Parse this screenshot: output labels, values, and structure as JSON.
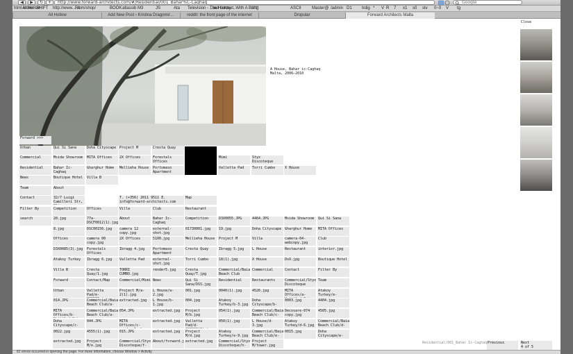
{
  "browser": {
    "url": "http://www.forward-architects.com/#/Residential/001_Bahar%C-Caghaq",
    "search_placeholder": "Google",
    "nav_back": "◀",
    "nav_forward": "▶",
    "nav_reload": "↻",
    "nav_add": "+",
    "bookmarks": [
      "html video",
      "All Hollow",
      "SHIFT",
      "http://www....com/shop/",
      "FA",
      "BOOK",
      "atlassib",
      "M3",
      "JS",
      "Ata",
      "Television - ...out context",
      "The History ...With A Bang",
      "!!!!!!",
      "ASCII",
      "Master@",
      "/admin",
      "D1",
      "trdig",
      "*",
      "V",
      "R",
      "7",
      "x1",
      "s0",
      "stv",
      "0~0",
      "V",
      "tg"
    ],
    "tabs": [
      {
        "label": "All Hollow",
        "active": false
      },
      {
        "label": "Add New Post ‹ Kristina Dragomir…",
        "active": false
      },
      {
        "label": "reddit: the front page of the internet",
        "active": false
      },
      {
        "label": "Dropular",
        "active": false
      },
      {
        "label": "Forward Architects Malta",
        "active": true
      }
    ],
    "status_text": "82 errors occurred in opening the page. For more information, choose Window > Activity."
  },
  "project": {
    "caption_title": "A House, Bahar ic-Caghaq",
    "caption_sub": "Malta, 2006–2010"
  },
  "thumbs": {
    "close_label": "Close"
  },
  "footer": {
    "path": "Residential/001_Bahar Ic-Caghaq",
    "previous": "Previous",
    "next": "Next",
    "count": "4 of 5"
  },
  "menu": {
    "forward": "Forward >>>"
  },
  "grid": [
    [
      "Urban",
      "Qui Si Sana",
      "Doha Cityscape",
      "Project M",
      "Cresta Quay"
    ],
    [
      "Commercial",
      "Msida Showroom",
      "MITA Offices",
      "2X Offices",
      "Forestals Offices",
      "",
      "Mimi",
      "Styx Discoteque"
    ],
    [
      "Residential",
      "Bahar Ic-Caghaq",
      "Gharghur Home",
      "Mellieha House",
      "Portomaso Apartment",
      "",
      "Valletta Pad",
      "Torri Cumbo",
      "X House"
    ],
    [
      "News",
      "Boutique Hotel",
      "Villa B"
    ],
    [
      "Team",
      "About"
    ],
    [
      "Contact",
      "32/7 Luigi Camilleri Str, Sliema, SLM1844 Malta",
      "",
      "T. (+356) 2011 9511 E. info@forward-architects.com",
      "",
      "Map"
    ],
    [
      "Filter By",
      "Competition",
      "Offices",
      "Villa",
      "Club",
      "Restaurant"
    ],
    [
      "search",
      "20.jpg",
      "77a-DSCF0012(1).jpg",
      "About",
      "Bahar Ic-Caghaq",
      "Competition",
      "D3X0055.JPG",
      "4464.JPG",
      "Msida Showroom",
      "Qui Si Sana"
    ],
    [
      "",
      "8.jpg",
      "DSC00156.jpg",
      "camera 12 copy.jpg",
      "external-shot.jpg",
      "01730001.jpg",
      "19.jpg",
      "Doha Cityscape",
      "Gharghur Home",
      "MITA Offices"
    ],
    [
      "",
      "Offices",
      "camera 00 copy.jpg",
      "2X Offices",
      "5100.jpg",
      "Mellieha House",
      "Project M",
      "Villa",
      "camera-04-webcopy.jpg",
      "Club"
    ],
    [
      "",
      "D3X0085(3).jpg",
      "Forestals Offices",
      "Ibragg 4.jpg",
      "Portomaso Apartment",
      "Cresta Quay",
      "Ibragg 5.jpg",
      "L House",
      "Restaurant",
      "interior.jpg"
    ],
    [
      "",
      "Atakoy Turkey",
      "Ibragg 6.jpg",
      "Valletta Pad",
      "external-shot.jpg",
      "Torri Cumbo",
      "18(1).jpg",
      "X House",
      "DsO.jpg",
      "Boutique Hotel"
    ],
    [
      "",
      "Villa B",
      "Cresta Quay/1.jpg",
      "TORRI CUMBO.jpg",
      "render5.jpg",
      "Cresta Quay/T.jpg",
      "Commercial/Baia Beach Club",
      "Commercial",
      "Contact",
      "Filter By"
    ],
    [
      "",
      "Forward",
      "Contact/Map",
      "Commercial/Mimi",
      "News",
      "Qui Si Sana/DSS.jpg",
      "Residential",
      "Restaurants",
      "Commercial/Styx Discoteque",
      "Team"
    ],
    [
      "",
      "Urban",
      "Valletta Pad/e-000032.jpg",
      "Project M/a-2(1).jpg",
      "L House/a-2.jpg",
      "001.jpg",
      "0040(1).jpg",
      "4526.jpg",
      "MITA Offices/a-Untitled-2.jpg",
      "Atakoy Turkey/e-"
    ],
    [
      "",
      "014.JPG",
      "Commercial/Baia Beach Club/a-",
      "extracted.jpg",
      "L House/b-1.jpg",
      "004.jpg",
      "Atakoy Turkey/b-3.jpg",
      "Doha Cityscape/b-",
      "0003.jpg",
      "4404.jpg"
    ],
    [
      "",
      "MITA Offices/b-Untitled-2.jpg",
      "Commercial/Baia Beach Club/a-",
      "054.JPG",
      "extracted.jpg",
      "Project M/b.jpg",
      "054(1).jpg",
      "Commercial/Baia Beach Club/c-",
      "Decosare-074 copy.jpg",
      "4505.jpg"
    ],
    [
      "",
      "Doha Cityscape/c-",
      "044.JPG",
      "MITA Offices/c-render 1 sky",
      "extracted.jpg",
      "Valletta Pad/d-000002(1).jpg",
      "050(1).jpg",
      "L House/d-3.jpg",
      "Atakoy Turkey/d-6.jpg",
      "Commercial/Baia Beach Club/d-"
    ],
    [
      "",
      "0022.jpg",
      "4555(1).jpg",
      "015.JPG",
      "extracted.jpg",
      "Project M/d.jpg",
      "Atakoy Turkey/e-9.jpg",
      "Commercial/Baia Beach Club/e-",
      "0015.jpg",
      "Doha Cityscape/e-"
    ],
    [
      "",
      "extracted.jpg",
      "Project M/e.jpg",
      "Commercial/Styx Discoteque/f-",
      "About/forward.jpg",
      "extracted.jpg",
      "Commercial/Styx Discoteque/h-",
      "Project M/tower.jpg"
    ]
  ]
}
